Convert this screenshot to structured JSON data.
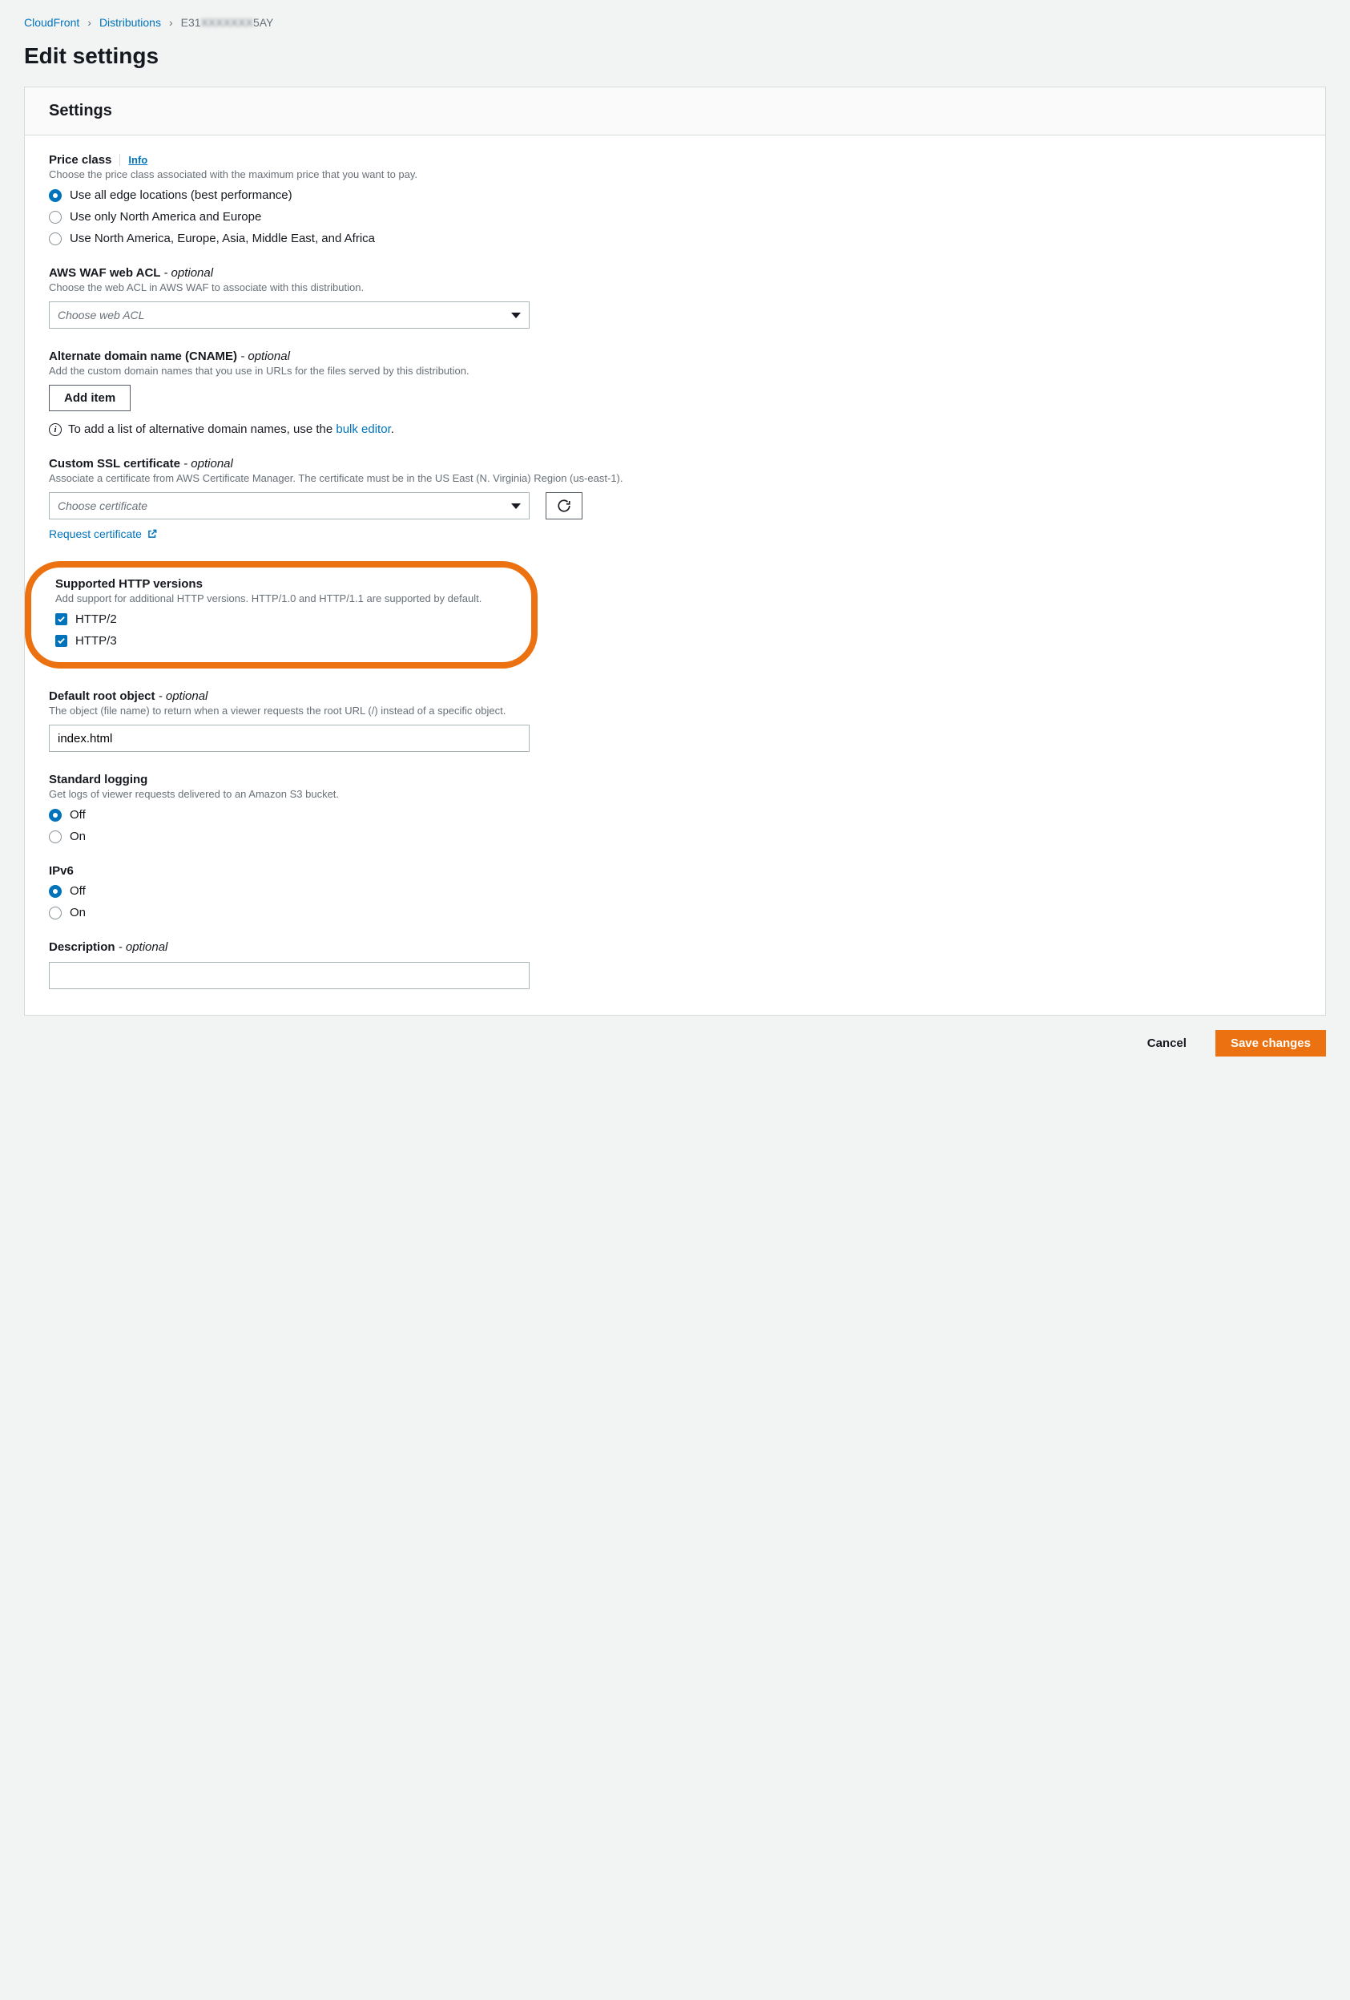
{
  "breadcrumb": {
    "items": [
      "CloudFront",
      "Distributions"
    ],
    "current_pre": "E31",
    "current_blur": "XXXXXXX",
    "current_post": "5AY"
  },
  "page_title": "Edit settings",
  "panel_title": "Settings",
  "price_class": {
    "label": "Price class",
    "info": "Info",
    "desc": "Choose the price class associated with the maximum price that you want to pay.",
    "options": [
      "Use all edge locations (best performance)",
      "Use only North America and Europe",
      "Use North America, Europe, Asia, Middle East, and Africa"
    ],
    "selected": 0
  },
  "waf": {
    "label": "AWS WAF web ACL",
    "optional": "- optional",
    "desc": "Choose the web ACL in AWS WAF to associate with this distribution.",
    "placeholder": "Choose web ACL"
  },
  "cname": {
    "label": "Alternate domain name (CNAME)",
    "optional": "- optional",
    "desc": "Add the custom domain names that you use in URLs for the files served by this distribution.",
    "add_btn": "Add item",
    "note_pre": "To add a list of alternative domain names, use the ",
    "note_link": "bulk editor",
    "note_post": "."
  },
  "ssl": {
    "label": "Custom SSL certificate",
    "optional": "- optional",
    "desc": "Associate a certificate from AWS Certificate Manager. The certificate must be in the US East (N. Virginia) Region (us-east-1).",
    "placeholder": "Choose certificate",
    "request_link": "Request certificate"
  },
  "http": {
    "label": "Supported HTTP versions",
    "desc": "Add support for additional HTTP versions. HTTP/1.0 and HTTP/1.1 are supported by default.",
    "options": [
      "HTTP/2",
      "HTTP/3"
    ],
    "checked": [
      true,
      true
    ]
  },
  "root": {
    "label": "Default root object",
    "optional": "- optional",
    "desc": "The object (file name) to return when a viewer requests the root URL (/) instead of a specific object.",
    "value": "index.html"
  },
  "logging": {
    "label": "Standard logging",
    "desc": "Get logs of viewer requests delivered to an Amazon S3 bucket.",
    "options": [
      "Off",
      "On"
    ],
    "selected": 0
  },
  "ipv6": {
    "label": "IPv6",
    "options": [
      "Off",
      "On"
    ],
    "selected": 0
  },
  "description": {
    "label": "Description",
    "optional": "- optional",
    "value": ""
  },
  "actions": {
    "cancel": "Cancel",
    "save": "Save changes"
  }
}
